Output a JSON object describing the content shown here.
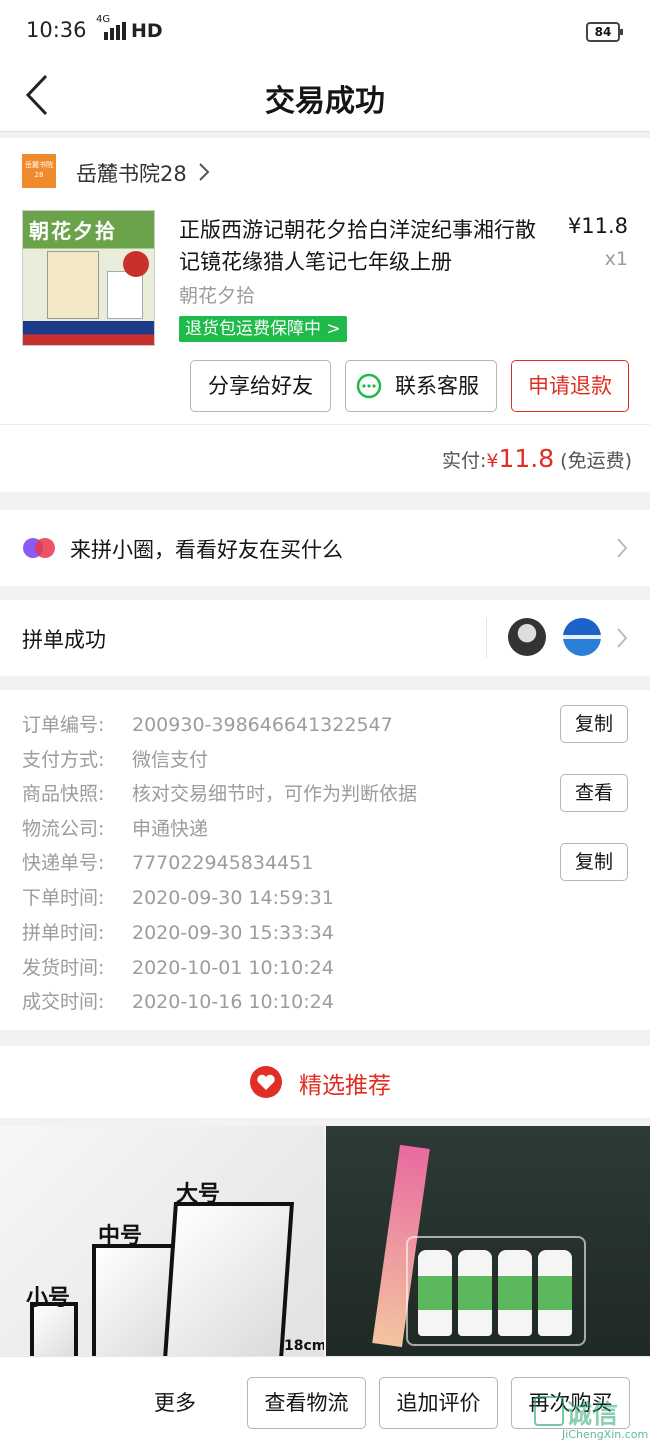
{
  "status": {
    "time": "10:36",
    "network": "4G",
    "hd": "HD",
    "battery": "84"
  },
  "nav": {
    "title": "交易成功"
  },
  "shop": {
    "logo_text": "岳麓书院28",
    "name": "岳麓书院28"
  },
  "product": {
    "cover_title": "朝花夕拾",
    "title": "正版西游记朝花夕拾白洋淀纪事湘行散记镜花缘猎人笔记七年级上册",
    "price": "¥11.8",
    "qty": "x1",
    "sku": "朝花夕拾",
    "guarantee": "退货包运费保障中 >"
  },
  "actions": {
    "share": "分享给好友",
    "service": "联系客服",
    "refund": "申请退款"
  },
  "payment": {
    "label": "实付:",
    "currency": "¥",
    "amount": "11.8",
    "shipping": "(免运费)"
  },
  "circle": {
    "text": "来拼小圈，看看好友在买什么"
  },
  "group": {
    "text": "拼单成功"
  },
  "info": {
    "rows": [
      {
        "k": "订单编号:",
        "v": "200930-398646641322547"
      },
      {
        "k": "支付方式:",
        "v": "微信支付"
      },
      {
        "k": "商品快照:",
        "v": "核对交易细节时，可作为判断依据"
      },
      {
        "k": "物流公司:",
        "v": "申通快递"
      },
      {
        "k": "快递单号:",
        "v": "777022945834451"
      },
      {
        "k": "下单时间:",
        "v": "2020-09-30 14:59:31"
      },
      {
        "k": "拼单时间:",
        "v": "2020-09-30 15:33:34"
      },
      {
        "k": "发货时间:",
        "v": "2020-10-01 10:10:24"
      },
      {
        "k": "成交时间:",
        "v": "2020-10-16 10:10:24"
      }
    ],
    "copy_label": "复制",
    "view_label": "查看"
  },
  "recommend": {
    "title": "精选推荐",
    "item1_labels": {
      "small": "小号",
      "medium": "中号",
      "large": "大号",
      "dim": "18cm)"
    }
  },
  "bottom": {
    "more": "更多",
    "logistics": "查看物流",
    "review": "追加评价",
    "rebuy": "再次购买"
  },
  "watermark": {
    "text": "诚信",
    "sub": "JiChengXin.com"
  },
  "colors": {
    "accent": "#e02e24",
    "green": "#1eba4a"
  }
}
